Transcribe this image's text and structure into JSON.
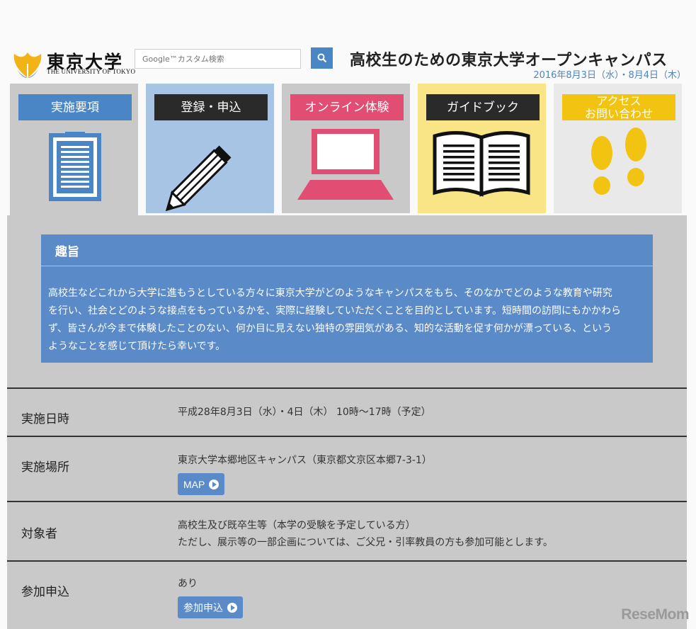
{
  "header": {
    "logo_jp": "東京大学",
    "logo_en": "THE UNIVERSITY OF TOKYO",
    "search_placeholder": "Google™カスタム検索",
    "title": "高校生のための東京大学オープンキャンパス",
    "date": "2016年8月3日（水）・8月4日（木）"
  },
  "tabs": [
    {
      "label": "実施要項",
      "color": "#4a86c5",
      "bg": "#c9c9c9",
      "icon": "document-icon"
    },
    {
      "label": "登録・申込",
      "color": "#2a2a2a",
      "bg": "#a8c4e4",
      "icon": "pencil-icon"
    },
    {
      "label": "オンライン体験",
      "color": "#e14d73",
      "bg": "#c9c9c9",
      "icon": "laptop-icon"
    },
    {
      "label": "ガイドブック",
      "color": "#2a2a2a",
      "bg": "#f9e585",
      "icon": "book-icon"
    },
    {
      "label_line1": "アクセス",
      "label_line2": "お問い合わせ",
      "color": "#f3c312",
      "bg": "#e9e9e9",
      "icon": "footprints-icon"
    }
  ],
  "purpose": {
    "heading": "趣旨",
    "line1": "高校生などこれから大学に進もうとしている方々に東京大学がどのようなキャンパスをもち、そのなかでどのような教育や研究",
    "line2": "を行い、社会とどのような接点をもっているかを、実際に経験していただくことを目的としています。短時間の訪問にもかかわら",
    "line3": "ず、皆さんが今まで体験したことのない、何か目に見えない独特の雰囲気がある、知的な活動を促す何かが漂っている、という",
    "line4": "ようなことを感じて頂けたら幸いです。"
  },
  "info": [
    {
      "label": "実施日時",
      "value": "平成28年8月3日（水）・4日（木） 10時～17時（予定）"
    },
    {
      "label": "実施場所",
      "value": "東京大学本郷地区キャンパス（東京都文京区本郷7-3-1）",
      "button": "MAP"
    },
    {
      "label": "対象者",
      "value": "高校生及び既卒生等（本学の受験を予定している方）",
      "value2": "ただし、展示等の一部企画については、ご父兄・引率教員の方も参加可能とします。"
    },
    {
      "label": "参加申込",
      "value": "あり",
      "button": "参加申込"
    }
  ],
  "watermark": "ReseMom"
}
